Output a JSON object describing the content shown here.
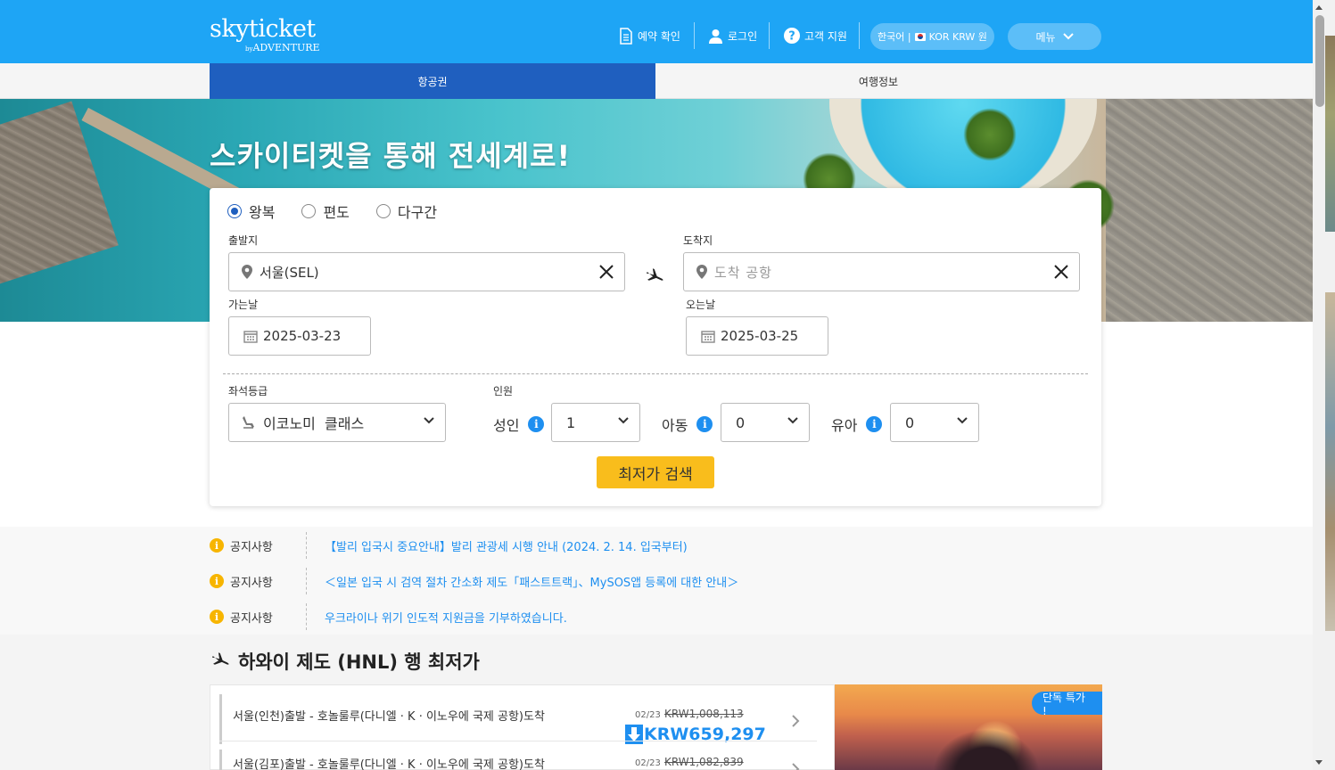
{
  "header": {
    "logo_main": "skyticket",
    "logo_by": "by",
    "logo_sub": "ADVENTURE",
    "nav": {
      "booking_check": "예약 확인",
      "login": "로그인",
      "support": "고객 지원"
    },
    "language": "한국어 |",
    "currency": "KOR KRW 원",
    "menu": "메뉴"
  },
  "tabs": {
    "flights": "항공권",
    "travel_info": "여행정보"
  },
  "hero": {
    "title": "스카이티켓을 통해 전세계로!"
  },
  "search": {
    "trip_types": [
      "왕복",
      "편도",
      "다구간"
    ],
    "selected_trip_type": "왕복",
    "departure_label": "출발지",
    "departure_value": "서울(SEL)",
    "arrival_label": "도착지",
    "arrival_placeholder": "도착 공항",
    "depart_date_label": "가는날",
    "depart_date": "2025-03-23",
    "return_date_label": "오는날",
    "return_date": "2025-03-25",
    "cabin_label": "좌석등급",
    "cabin_value": "이코노미  클래스",
    "pax_label": "인원",
    "adult_label": "성인",
    "adult_value": "1",
    "child_label": "아동",
    "child_value": "0",
    "infant_label": "유아",
    "infant_value": "0",
    "submit": "최저가 검색"
  },
  "notices": [
    {
      "label": "공지사항",
      "text": "【발리 입국시 중요안내】발리 관광세 시행 안내 (2024. 2. 14. 입국부터)"
    },
    {
      "label": "공지사항",
      "text": "＜일본 입국 시 검역 절차 간소화 제도「패스트트랙」、MySOS앱 등록에 대한 안내＞"
    },
    {
      "label": "공지사항",
      "text": "우크라이나 위기 인도적 지원금을 기부하였습니다."
    }
  ],
  "deals": {
    "title": "하와이 제도 (HNL) 행 최저가",
    "badge": "단독 특가 !",
    "items": [
      {
        "route": "서울(인천)출발 - 호놀룰루(다니엘 · K · 이노우에 국제 공항)도착",
        "date": "02/23",
        "old_price": "KRW1,008,113",
        "new_price": "KRW659,297"
      },
      {
        "route": "서울(김포)출발 - 호놀룰루(다니엘 · K · 이노우에 국제 공항)도착",
        "date": "02/23",
        "old_price": "KRW1,082,839"
      }
    ]
  },
  "colors": {
    "header_bg": "#1ea5f5",
    "tab_active": "#1f5fbf",
    "search_button": "#f9bd1c",
    "link": "#1e8ff0",
    "notice_icon": "#f7b500"
  }
}
